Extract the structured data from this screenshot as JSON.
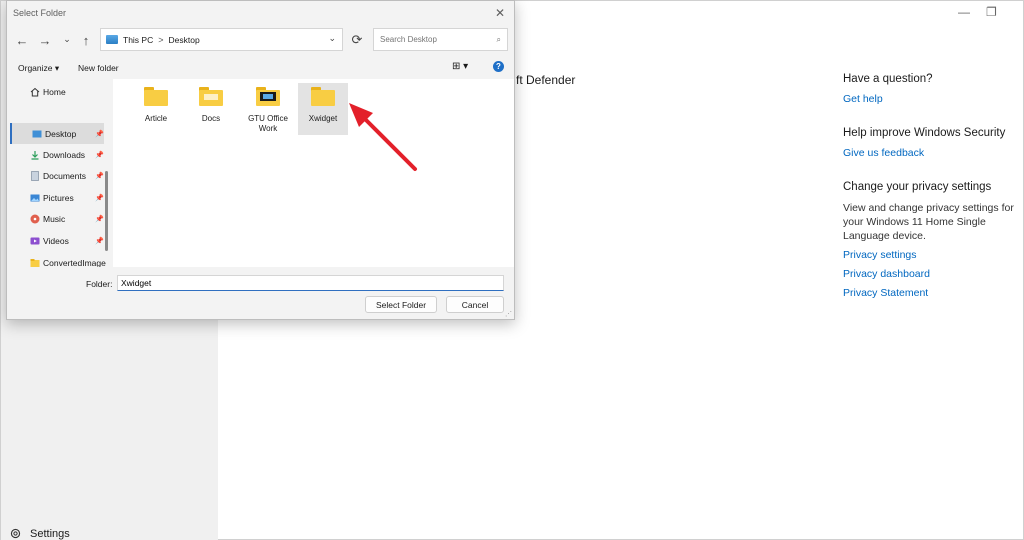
{
  "dialog": {
    "title": "Select Folder",
    "close_glyph": "✕",
    "nav": {
      "back": "←",
      "forward": "→",
      "recent": "⌄",
      "up": "↑"
    },
    "address": {
      "segments": [
        "This PC",
        "Desktop"
      ],
      "separator": ">",
      "dropdown_glyph": "⌄",
      "refresh_glyph": "⟳"
    },
    "search": {
      "placeholder": "Search Desktop",
      "icon_glyph": "⌕"
    },
    "toolbar": {
      "organize": "Organize ▾",
      "new_folder": "New folder",
      "view_glyph": "⊞ ▾",
      "help_glyph": "?"
    },
    "nav_pane": [
      {
        "label": "Home",
        "icon": "home-icon",
        "pinned": false,
        "selected": false
      },
      {
        "label": "Desktop",
        "icon": "desktop-icon",
        "pinned": true,
        "selected": true
      },
      {
        "label": "Downloads",
        "icon": "download-icon",
        "pinned": true,
        "selected": false
      },
      {
        "label": "Documents",
        "icon": "document-icon",
        "pinned": true,
        "selected": false
      },
      {
        "label": "Pictures",
        "icon": "pictures-icon",
        "pinned": true,
        "selected": false
      },
      {
        "label": "Music",
        "icon": "music-icon",
        "pinned": true,
        "selected": false
      },
      {
        "label": "Videos",
        "icon": "videos-icon",
        "pinned": true,
        "selected": false
      },
      {
        "label": "ConvertedImage",
        "icon": "folder-icon",
        "pinned": false,
        "selected": false
      }
    ],
    "pin_glyph": "📌",
    "folders": [
      {
        "label": "Article",
        "selected": false
      },
      {
        "label": "Docs",
        "selected": false
      },
      {
        "label": "GTU Office Work",
        "selected": false
      },
      {
        "label": "Xwidget",
        "selected": true
      }
    ],
    "footer": {
      "folder_label": "Folder:",
      "folder_value": "Xwidget",
      "select_button": "Select Folder",
      "cancel_button": "Cancel"
    }
  },
  "background": {
    "partial_title": "ft Defender",
    "minimize_glyph": "—",
    "maximize_glyph": "❐",
    "settings_label": "Settings",
    "right_panel": {
      "question_heading": "Have a question?",
      "get_help": "Get help",
      "improve_heading": "Help improve Windows Security",
      "feedback": "Give us feedback",
      "privacy_heading": "Change your privacy settings",
      "privacy_text": "View and change privacy settings for your Windows 11 Home Single Language device.",
      "privacy_settings": "Privacy settings",
      "privacy_dashboard": "Privacy dashboard",
      "privacy_statement": "Privacy Statement"
    }
  },
  "colors": {
    "accent": "#0067c0",
    "arrow": "#e3202a",
    "folder": "#f8cd43"
  }
}
